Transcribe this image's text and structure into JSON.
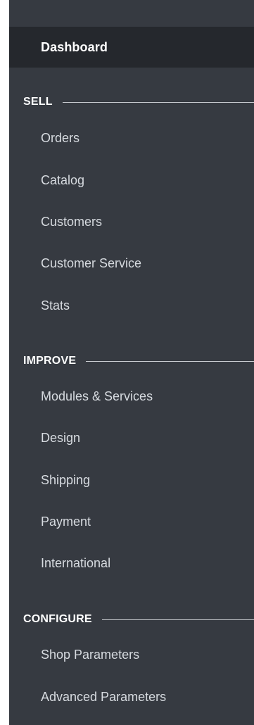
{
  "sidebar": {
    "dashboard": "Dashboard",
    "sections": [
      {
        "title": "SELL",
        "items": [
          "Orders",
          "Catalog",
          "Customers",
          "Customer Service",
          "Stats"
        ]
      },
      {
        "title": "IMPROVE",
        "items": [
          "Modules & Services",
          "Design",
          "Shipping",
          "Payment",
          "International"
        ]
      },
      {
        "title": "CONFIGURE",
        "items": [
          "Shop Parameters",
          "Advanced Parameters"
        ]
      }
    ]
  },
  "colors": {
    "sidebar_bg": "#363a41",
    "active_bg": "#25282d",
    "text": "#d7dbe0",
    "heading": "#ffffff"
  }
}
